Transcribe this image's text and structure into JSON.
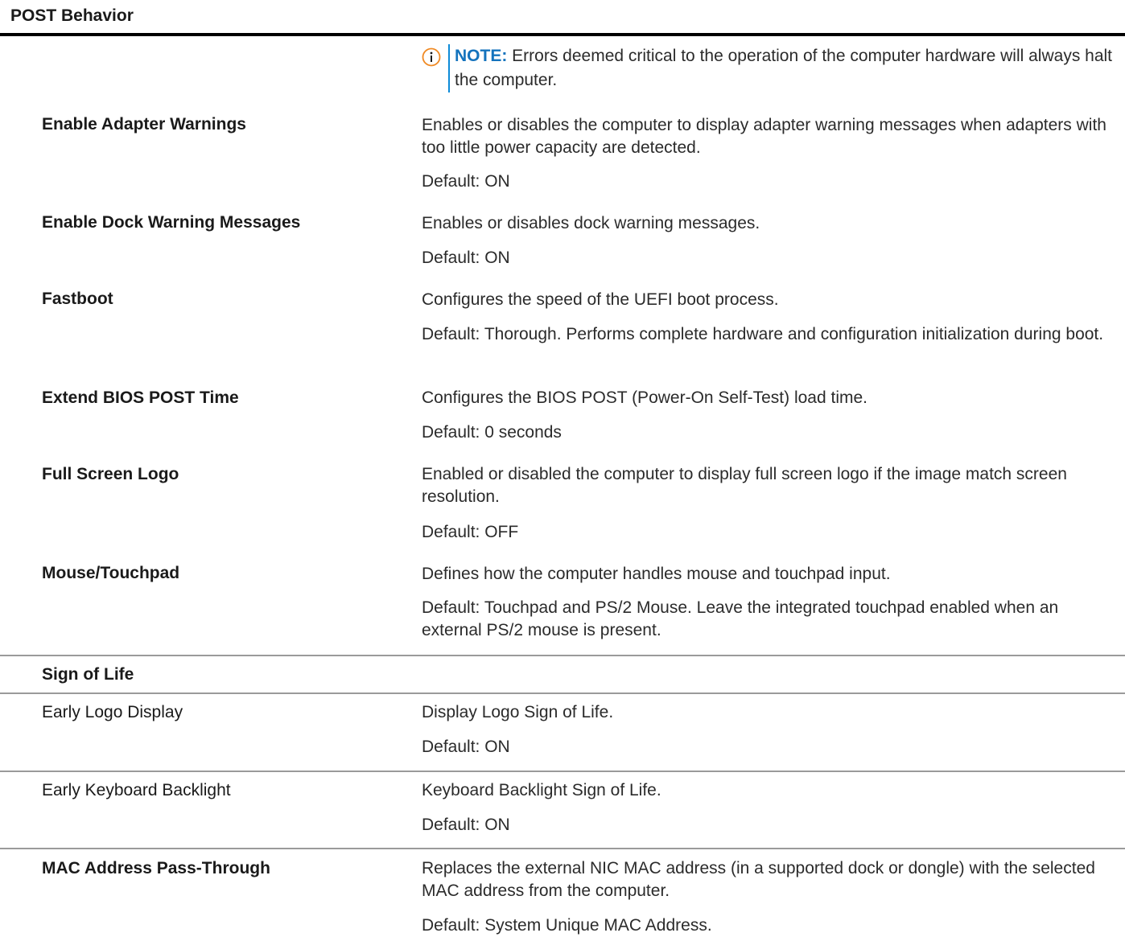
{
  "section": {
    "title": "POST Behavior"
  },
  "note": {
    "label": "NOTE:",
    "text": " Errors deemed critical to the operation of the computer hardware will always halt the computer."
  },
  "rows": [
    {
      "label": "Enable Adapter Warnings",
      "desc": "Enables or disables the computer to display adapter warning messages when adapters with too little power capacity are detected.",
      "default": "Default: ON"
    },
    {
      "label": "Enable Dock Warning Messages",
      "desc": "Enables or disables dock warning messages.",
      "default": "Default: ON"
    },
    {
      "label": "Fastboot",
      "desc": "Configures the speed of the UEFI boot process.",
      "default": "Default: Thorough. Performs complete hardware and configuration initialization during boot."
    },
    {
      "label": "Extend BIOS POST Time",
      "desc": "Configures the BIOS POST (Power-On Self-Test) load time.",
      "default": "Default: 0 seconds"
    },
    {
      "label": "Full Screen Logo",
      "desc": "Enabled or disabled the computer to display full screen logo if the image match screen resolution.",
      "default": "Default: OFF"
    },
    {
      "label": "Mouse/Touchpad",
      "desc": "Defines how the computer handles mouse and touchpad input.",
      "default": "Default: Touchpad and PS/2 Mouse. Leave the integrated touchpad enabled when an external PS/2 mouse is present."
    }
  ],
  "sign_of_life": {
    "title": "Sign of Life",
    "items": [
      {
        "label": "Early Logo Display",
        "desc": "Display Logo Sign of Life.",
        "default": "Default: ON"
      },
      {
        "label": "Early Keyboard Backlight",
        "desc": "Keyboard Backlight Sign of Life.",
        "default": "Default: ON"
      }
    ]
  },
  "mac": {
    "label": "MAC Address Pass-Through",
    "desc": "Replaces the external NIC MAC address (in a supported dock or dongle) with the selected MAC address from the computer.",
    "default": "Default: System Unique MAC Address."
  },
  "icons": {
    "note": "info-circle-icon"
  },
  "colors": {
    "note_accent": "#1473bd",
    "note_bar": "#0e8bd8"
  }
}
